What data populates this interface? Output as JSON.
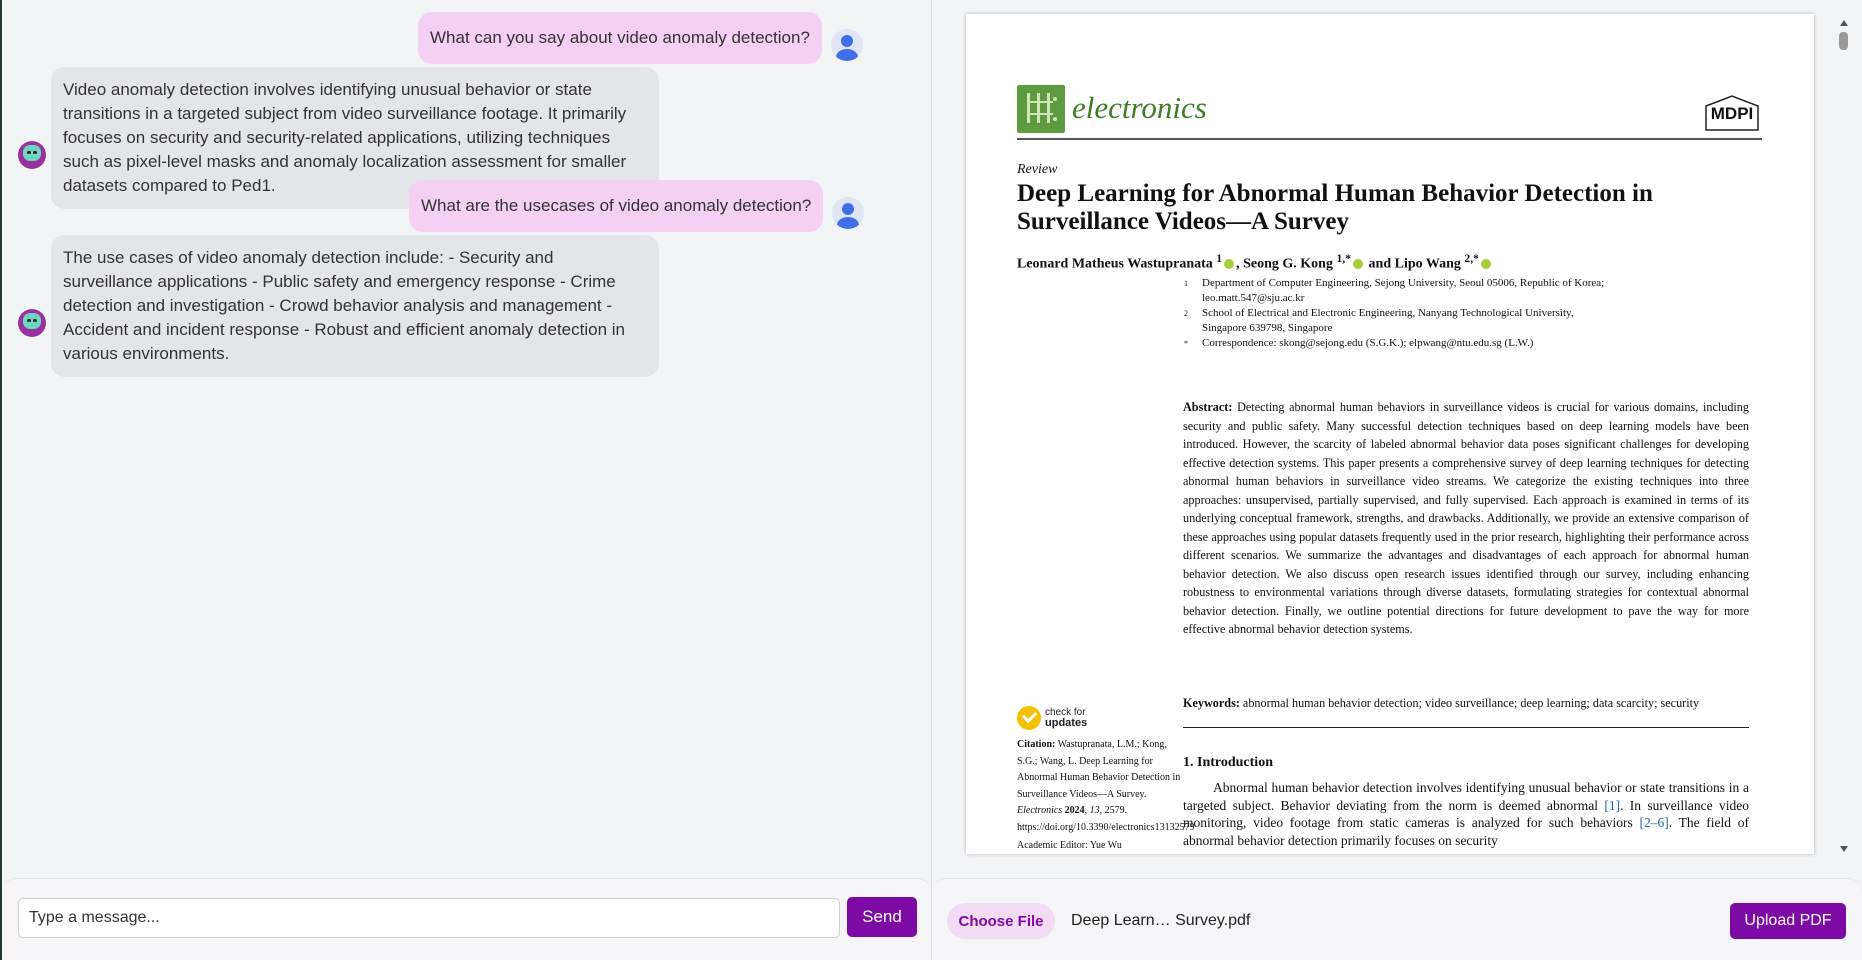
{
  "chat": {
    "messages": [
      {
        "role": "user",
        "text": "What can you say about video anomaly detection?"
      },
      {
        "role": "bot",
        "text": "Video anomaly detection involves identifying unusual behavior or state transitions in a targeted subject from video surveillance footage. It primarily focuses on security and security-related applications, utilizing techniques such as pixel-level masks and anomaly localization assessment for smaller datasets compared to Ped1."
      },
      {
        "role": "user",
        "text": "What are the usecases of video anomaly detection?"
      },
      {
        "role": "bot",
        "text": "The use cases of video anomaly detection include: - Security and surveillance applications - Public safety and emergency response - Crime detection and investigation - Crowd behavior analysis and management - Accident and incident response - Robust and efficient anomaly detection in various environments."
      }
    ],
    "input_placeholder": "Type a message...",
    "send_label": "Send"
  },
  "pdf": {
    "journal": "electronics",
    "publisher": "MDPI",
    "article_type": "Review",
    "title": "Deep Learning for Abnormal Human Behavior Detection in Surveillance Videos—A Survey",
    "authors": {
      "a1": "Leonard Matheus Wastupranata",
      "a1_sup": "1",
      "a2": ", Seong G. Kong",
      "a2_sup": "1,*",
      "a3": " and Lipo Wang",
      "a3_sup": "2,*"
    },
    "affiliations": [
      {
        "mark": "1",
        "text": "Department of Computer Engineering, Sejong University, Seoul 05006, Republic of Korea; leo.matt.547@sju.ac.kr"
      },
      {
        "mark": "2",
        "text": "School of Electrical and Electronic Engineering, Nanyang Technological University, Singapore 639798, Singapore"
      },
      {
        "mark": "*",
        "text": "Correspondence: skong@sejong.edu (S.G.K.); elpwang@ntu.edu.sg (L.W.)"
      }
    ],
    "abstract_label": "Abstract:",
    "abstract": "Detecting abnormal human behaviors in surveillance videos is crucial for various domains, including security and public safety. Many successful detection techniques based on deep learning models have been introduced. However, the scarcity of labeled abnormal behavior data poses significant challenges for developing effective detection systems. This paper presents a comprehensive survey of deep learning techniques for detecting abnormal human behaviors in surveillance video streams. We categorize the existing techniques into three approaches: unsupervised, partially supervised, and fully supervised. Each approach is examined in terms of its underlying conceptual framework, strengths, and drawbacks. Additionally, we provide an extensive comparison of these approaches using popular datasets frequently used in the prior research, highlighting their performance across different scenarios. We summarize the advantages and disadvantages of each approach for abnormal human behavior detection. We also discuss open research issues identified through our survey, including enhancing robustness to environmental variations through diverse datasets, formulating strategies for contextual abnormal behavior detection. Finally, we outline potential directions for future development to pave the way for more effective abnormal behavior detection systems.",
    "keywords_label": "Keywords:",
    "keywords": "abnormal human behavior detection; video surveillance; deep learning; data scarcity; security",
    "check_updates": {
      "line1": "check for",
      "line2": "updates"
    },
    "citation_label": "Citation:",
    "citation_text": "Wastupranata, L.M.; Kong, S.G.; Wang, L. Deep Learning for Abnormal Human Behavior Detection in Surveillance Videos—A Survey.",
    "citation_journal": "Electronics",
    "citation_year": "2024",
    "citation_vol": "13",
    "citation_rest": ", 2579. https://doi.org/10.3390/electronics13132579",
    "academic_editor": "Academic Editor: Yue Wu",
    "section_title": "1. Introduction",
    "intro_p1": "Abnormal human behavior detection involves identifying unusual behavior or state transitions in a targeted subject. Behavior deviating from the norm is deemed abnormal ",
    "intro_ref1": "[1]",
    "intro_p2": ". In surveillance video monitoring, video footage from static cameras is analyzed for such behaviors ",
    "intro_ref2": "[2–6]",
    "intro_p3": ". The field of abnormal behavior detection primarily focuses on security"
  },
  "upload": {
    "choose_label": "Choose File",
    "file_name": "Deep Learn… Survey.pdf",
    "upload_label": "Upload PDF"
  },
  "colors": {
    "accent": "#7e0aa6",
    "user_bubble": "#f5d0f5",
    "bot_bubble": "#e4e5e9",
    "journal_green": "#3f7d24"
  }
}
